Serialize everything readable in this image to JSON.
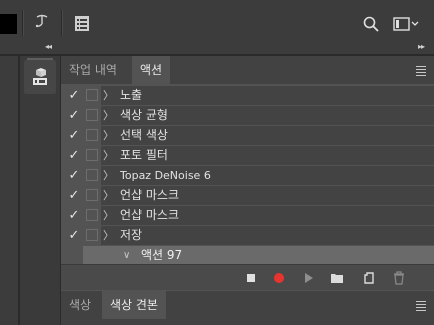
{
  "colors": {
    "accent_record": "#e8332f",
    "panel_bg": "#535353",
    "chrome_bg": "#3c3c3c"
  },
  "toolbar": {
    "icons": [
      "foreground-color-swatch",
      "puppet-warp-icon",
      "properties-panel-icon",
      "search-icon",
      "workspace-icon"
    ]
  },
  "actions_panel": {
    "tabs": [
      {
        "label": "작업 내역",
        "active": false
      },
      {
        "label": "액션",
        "active": true
      }
    ],
    "items": [
      {
        "checked": true,
        "label": "노출"
      },
      {
        "checked": true,
        "label": "색상 균형"
      },
      {
        "checked": true,
        "label": "선택 색상"
      },
      {
        "checked": true,
        "label": "포토 필터"
      },
      {
        "checked": true,
        "label": "Topaz DeNoise 6"
      },
      {
        "checked": true,
        "label": "언샵 마스크"
      },
      {
        "checked": true,
        "label": "언샵 마스크"
      },
      {
        "checked": true,
        "label": "저장"
      }
    ],
    "action_set": {
      "label": "액션 97",
      "expanded": true
    }
  },
  "swatches_panel": {
    "tabs": [
      {
        "label": "색상",
        "active": false
      },
      {
        "label": "색상 견본",
        "active": true
      }
    ]
  }
}
